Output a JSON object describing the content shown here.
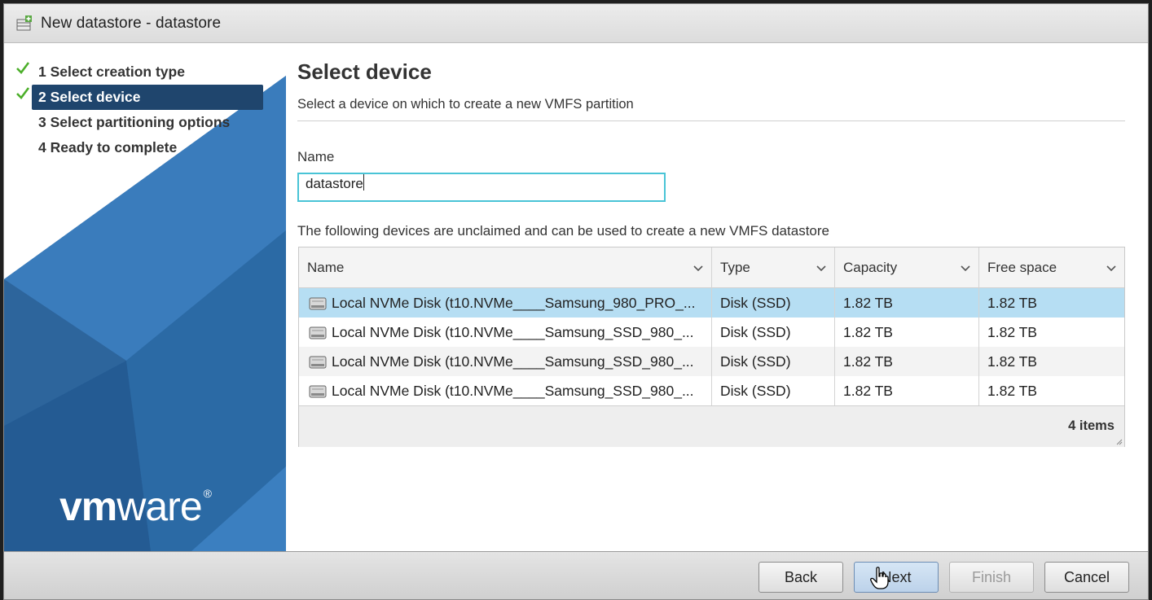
{
  "window": {
    "title": "New datastore - datastore"
  },
  "sidebar": {
    "steps": [
      {
        "label": "1 Select creation type",
        "done": true
      },
      {
        "label": "2 Select device",
        "done": true,
        "active": true
      },
      {
        "label": "3 Select partitioning options",
        "done": false
      },
      {
        "label": "4 Ready to complete",
        "done": false
      }
    ],
    "logo": {
      "prefix": "vm",
      "suffix": "ware",
      "mark": "®"
    }
  },
  "main": {
    "heading": "Select device",
    "subtitle": "Select a device on which to create a new VMFS partition",
    "name_label": "Name",
    "name_value": "datastore",
    "devices_text": "The following devices are unclaimed and can be used to create a new VMFS datastore"
  },
  "grid": {
    "columns": [
      "Name",
      "Type",
      "Capacity",
      "Free space"
    ],
    "rows": [
      {
        "name": "Local NVMe Disk (t10.NVMe____Samsung_980_PRO_...",
        "type": "Disk (SSD)",
        "capacity": "1.82 TB",
        "free": "1.82 TB",
        "selected": true
      },
      {
        "name": "Local NVMe Disk (t10.NVMe____Samsung_SSD_980_...",
        "type": "Disk (SSD)",
        "capacity": "1.82 TB",
        "free": "1.82 TB",
        "selected": false
      },
      {
        "name": "Local NVMe Disk (t10.NVMe____Samsung_SSD_980_...",
        "type": "Disk (SSD)",
        "capacity": "1.82 TB",
        "free": "1.82 TB",
        "selected": false
      },
      {
        "name": "Local NVMe Disk (t10.NVMe____Samsung_SSD_980_...",
        "type": "Disk (SSD)",
        "capacity": "1.82 TB",
        "free": "1.82 TB",
        "selected": false
      }
    ],
    "footer_count": "4 items"
  },
  "buttons": {
    "back": "Back",
    "next": "Next",
    "finish": "Finish",
    "cancel": "Cancel"
  },
  "colors": {
    "sidebar_blue": "#2f6da6",
    "active_step": "#1f456d",
    "selected_row": "#b6def3",
    "input_focus": "#49c4d6",
    "check_green": "#4caf2a"
  }
}
